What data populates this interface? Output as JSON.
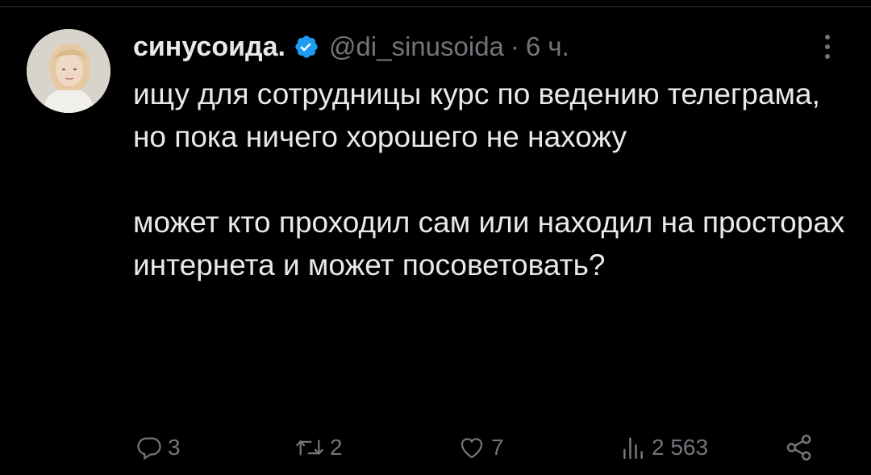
{
  "tweet": {
    "display_name": "синусоида.",
    "handle": "@di_sinusoida",
    "separator": "·",
    "time": "6 ч.",
    "paragraphs": [
      "ищу для сотрудницы курс по ведению телеграма, но пока ничего хорошего не нахожу",
      "может кто проходил сам или находил на просторах интернета и может посоветовать?"
    ]
  },
  "stats": {
    "replies": "3",
    "retweets": "2",
    "likes": "7",
    "views": "2 563"
  },
  "colors": {
    "background": "#000000",
    "text": "#e7e9ea",
    "secondary": "#71767b",
    "verified": "#1d9bf0"
  },
  "icons": [
    "verified-badge-icon",
    "more-options-icon",
    "reply-icon",
    "retweet-icon",
    "like-icon",
    "views-icon",
    "share-icon"
  ]
}
